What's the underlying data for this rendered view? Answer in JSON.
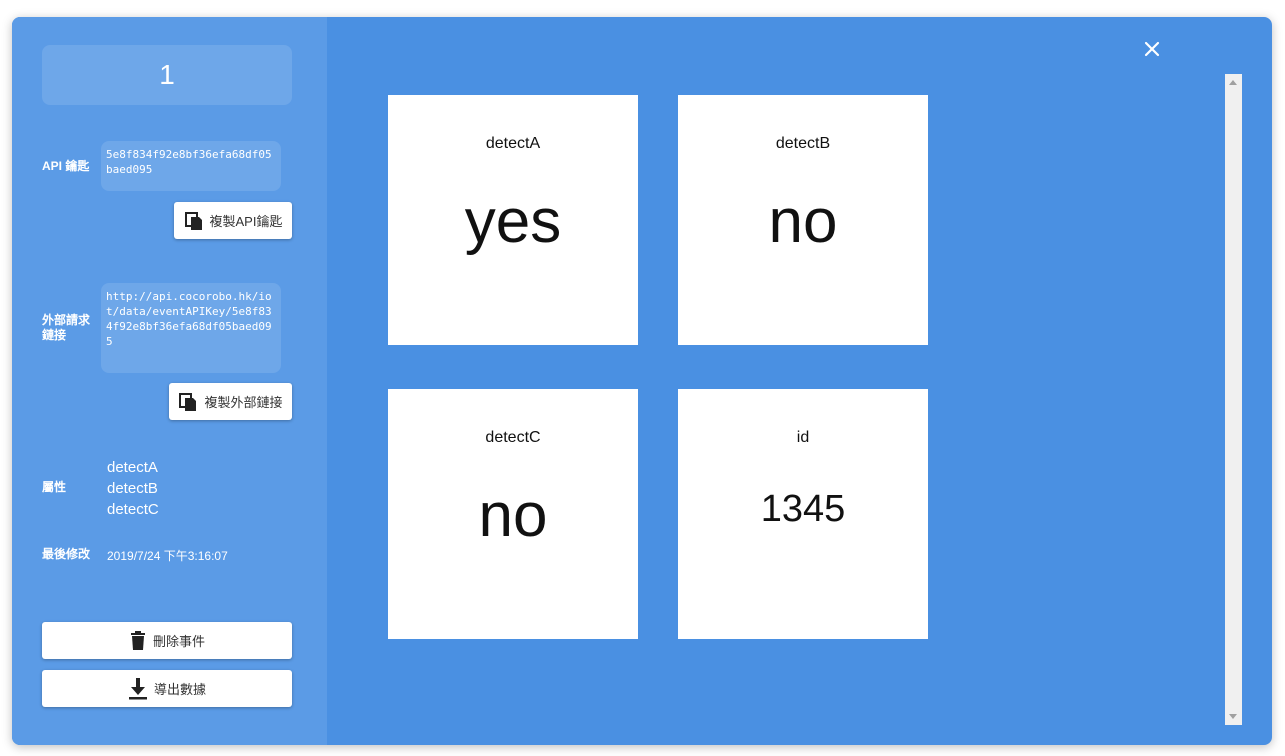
{
  "sidebar": {
    "event_id": "1",
    "api_key_label": "API 鑰匙",
    "api_key_value": "5e8f834f92e8bf36efa68df05baed095",
    "copy_api_key_label": "複製API鑰匙",
    "external_url_label": "外部請求鏈接",
    "external_url_value": "http://api.cocorobo.hk/iot/data/eventAPIKey/5e8f834f92e8bf36efa68df05baed095",
    "copy_external_url_label": "複製外部鏈接",
    "attributes_label": "屬性",
    "attributes": [
      "detectA",
      "detectB",
      "detectC"
    ],
    "last_modified_label": "最後修改",
    "last_modified_value": "2019/7/24 下午3:16:07",
    "delete_event_label": "刪除事件",
    "export_data_label": "導出數據"
  },
  "cards": [
    {
      "title": "detectA",
      "value": "yes"
    },
    {
      "title": "detectB",
      "value": "no"
    },
    {
      "title": "detectC",
      "value": "no"
    },
    {
      "title": "id",
      "value": "1345"
    }
  ],
  "icons": {
    "close": "close-icon",
    "copy": "copy-icon",
    "delete": "trash-icon",
    "export": "download-icon"
  },
  "colors": {
    "modal_bg": "#4a90e2",
    "sidebar_bg": "#5b9be6",
    "field_bg": "#6ea7e9"
  }
}
